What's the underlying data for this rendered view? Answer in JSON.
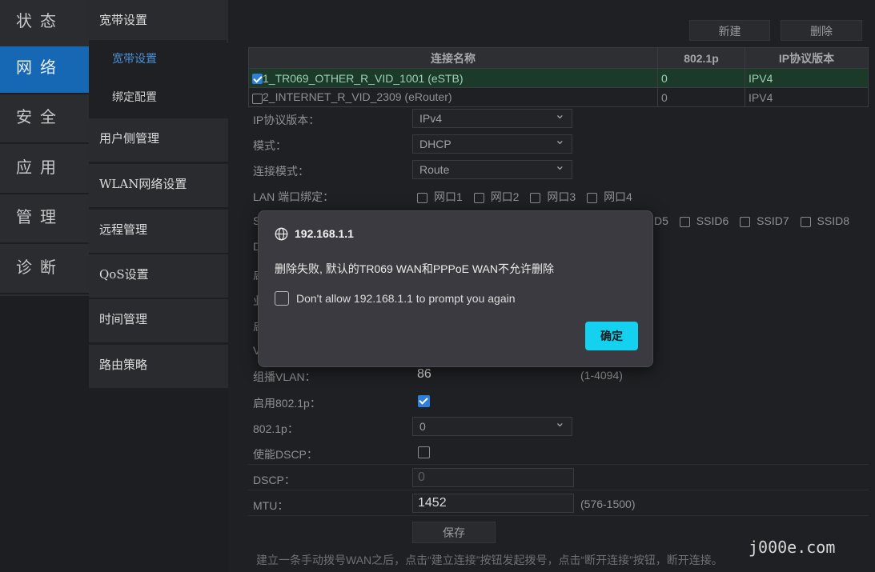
{
  "nav_primary": [
    "状态",
    "网络",
    "安全",
    "应用",
    "管理",
    "诊断"
  ],
  "nav_secondary": {
    "group_title": "宽带设置",
    "subitems": [
      "宽带设置",
      "绑定配置"
    ],
    "items": [
      "用户侧管理",
      "WLAN网络设置",
      "远程管理",
      "QoS设置",
      "时间管理",
      "路由策略"
    ]
  },
  "toolbar": {
    "new_label": "新建",
    "delete_label": "删除"
  },
  "wan_table": {
    "headers": [
      "连接名称",
      "802.1p",
      "IP协议版本"
    ],
    "rows": [
      {
        "name": "1_TR069_OTHER_R_VID_1001 (eSTB)",
        "p8021": "0",
        "ipver": "IPV4",
        "selected": true
      },
      {
        "name": "2_INTERNET_R_VID_2309 (eRouter)",
        "p8021": "0",
        "ipver": "IPV4",
        "selected": false
      }
    ]
  },
  "form": {
    "ip_version": {
      "label": "IP协议版本：",
      "value": "IPv4"
    },
    "mode": {
      "label": "模式：",
      "value": "DHCP"
    },
    "conn_mode": {
      "label": "连接模式：",
      "value": "Route"
    },
    "lan_bind": {
      "label": "LAN 端口绑定：",
      "options": [
        "网口1",
        "网口2",
        "网口3",
        "网口4"
      ]
    },
    "ssid_bind": {
      "label_prefix": "S",
      "options": [
        "D5",
        "SSID6",
        "SSID7",
        "SSID8"
      ]
    },
    "hidden_row_prefixes": [
      "D",
      "启",
      "业",
      "启",
      "V"
    ],
    "multicast_vlan": {
      "label": "组播VLAN：",
      "value": "86",
      "hint": "(1-4094)"
    },
    "enable_8021p": {
      "label": "启用802.1p："
    },
    "p8021": {
      "label": "802.1p：",
      "value": "0"
    },
    "enable_dscp": {
      "label": "使能DSCP："
    },
    "dscp": {
      "label": "DSCP：",
      "placeholder": "0"
    },
    "mtu": {
      "label": "MTU：",
      "value": "1452",
      "hint": "(576-1500)"
    },
    "save_label": "保存"
  },
  "footer_note": "建立一条手动拨号WAN之后，点击“建立连接”按钮发起拨号，点击“断开连接”按钮，断开连接。",
  "dialog": {
    "host": "192.168.1.1",
    "message": "删除失败, 默认的TR069 WAN和PPPoE WAN不允许删除",
    "checkbox_label": "Don't allow 192.168.1.1 to prompt you again",
    "ok_label": "确定"
  },
  "watermark": "j000e.com"
}
